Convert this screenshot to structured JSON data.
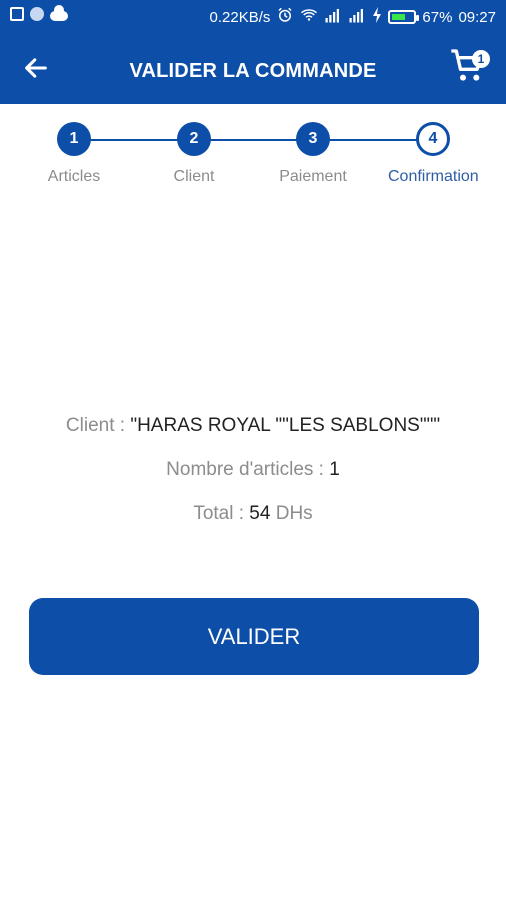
{
  "status_bar": {
    "left_icons": [
      "image-icon",
      "circle-icon",
      "cloud-icon"
    ],
    "network_speed": "0.22KB/s",
    "battery_percent": "67%",
    "time": "09:27",
    "battery_level": 0.67
  },
  "header": {
    "title": "VALIDER LA COMMANDE",
    "cart_count": "1"
  },
  "stepper": {
    "steps": [
      {
        "number": "1",
        "label": "Articles"
      },
      {
        "number": "2",
        "label": "Client"
      },
      {
        "number": "3",
        "label": "Paiement"
      },
      {
        "number": "4",
        "label": "Confirmation"
      }
    ]
  },
  "summary": {
    "client_label": "Client : ",
    "client_value": "\"HARAS ROYAL \"\"LES SABLONS\"\"\"",
    "articles_label": "Nombre d'articles : ",
    "articles_value": "1",
    "total_label": "Total : ",
    "total_value": "54",
    "currency": " DHs"
  },
  "actions": {
    "validate_label": "VALIDER"
  },
  "colors": {
    "primary": "#0d4fa8",
    "muted_text": "#8c8c8c",
    "battery_fill": "#39e64a"
  }
}
